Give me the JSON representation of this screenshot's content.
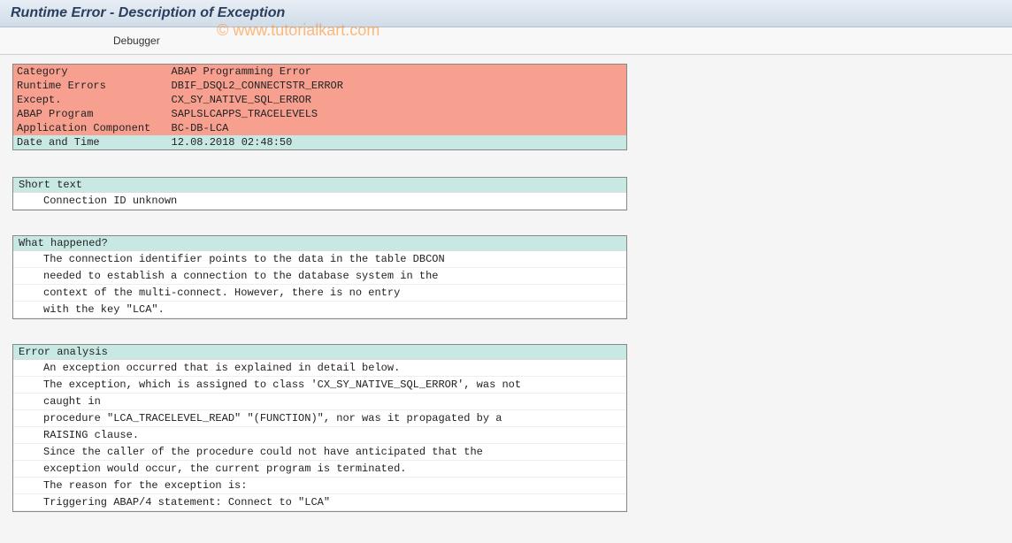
{
  "watermark": "© www.tutorialkart.com",
  "header": {
    "title": "Runtime Error - Description of Exception"
  },
  "toolbar": {
    "debugger_label": "Debugger"
  },
  "info": {
    "rows": [
      {
        "label": "Category",
        "value": "ABAP Programming Error",
        "style": "red"
      },
      {
        "label": "Runtime Errors",
        "value": "DBIF_DSQL2_CONNECTSTR_ERROR",
        "style": "red"
      },
      {
        "label": "Except.",
        "value": "CX_SY_NATIVE_SQL_ERROR",
        "style": "red"
      },
      {
        "label": "ABAP Program",
        "value": "SAPLSLCAPPS_TRACELEVELS",
        "style": "red"
      },
      {
        "label": "Application Component",
        "value": "BC-DB-LCA",
        "style": "red"
      },
      {
        "label": "Date and Time",
        "value": "12.08.2018 02:48:50",
        "style": "teal"
      }
    ]
  },
  "sections": {
    "short_text": {
      "title": "Short text",
      "lines": [
        "Connection ID unknown"
      ]
    },
    "what_happened": {
      "title": "What happened?",
      "lines": [
        "The connection identifier points to the data in the table DBCON",
        "needed to establish a connection to the database system in the",
        "context of the multi-connect. However, there is no entry",
        "with the key \"LCA\"."
      ]
    },
    "error_analysis": {
      "title": "Error analysis",
      "lines": [
        "An exception occurred that is explained in detail below.",
        "The exception, which is assigned to class 'CX_SY_NATIVE_SQL_ERROR', was not",
        " caught in",
        "procedure \"LCA_TRACELEVEL_READ\" \"(FUNCTION)\", nor was it propagated by a",
        " RAISING clause.",
        "Since the caller of the procedure could not have anticipated that the",
        "exception would occur, the current program is terminated.",
        "The reason for the exception is:",
        "Triggering ABAP/4 statement: Connect to \"LCA\""
      ]
    }
  }
}
